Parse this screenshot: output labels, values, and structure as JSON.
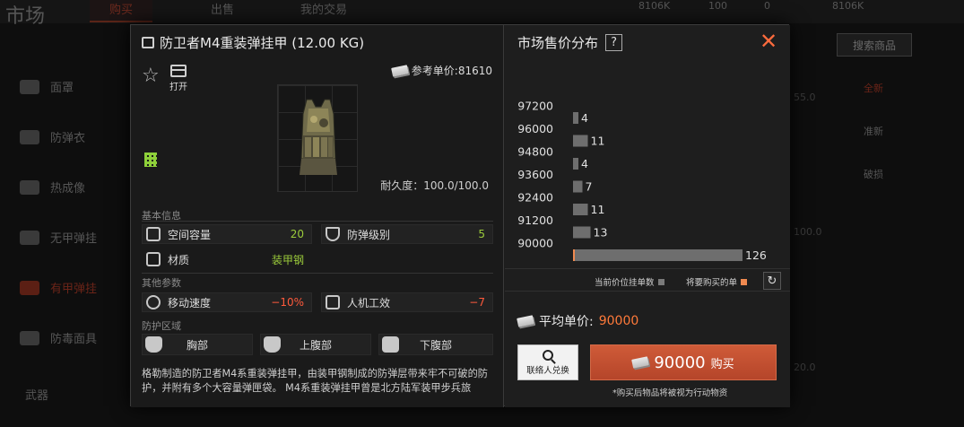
{
  "background": {
    "title": "市场",
    "tabs": [
      "购买",
      "出售",
      "我的交易"
    ],
    "currency": [
      "8106K",
      "100",
      "0",
      "8106K"
    ],
    "sidebar": [
      "面罩",
      "防弹衣",
      "热成像",
      "无甲弹挂",
      "有甲弹挂",
      "防毒面具",
      "武器"
    ],
    "search_btn": "搜索商品",
    "right_items": [
      "全新",
      "准新",
      "破损"
    ],
    "ghost": [
      "55.0",
      "100.0",
      "20.0"
    ]
  },
  "item": {
    "name": "防卫者M4重装弹挂甲 (12.00 KG)",
    "open_label": "打开",
    "ref_price": "参考单价:81610",
    "durability": "耐久度：100.0/100.0",
    "basic_label": "基本信息",
    "stats_basic": [
      {
        "name": "空间容量",
        "value": "20"
      },
      {
        "name": "防弹级别",
        "value": "5"
      },
      {
        "name": "材质",
        "value": "装甲钢"
      }
    ],
    "other_label": "其他参数",
    "stats_other": [
      {
        "name": "移动速度",
        "value": "−10%"
      },
      {
        "name": "人机工效",
        "value": "−7"
      }
    ],
    "zones_label": "防护区域",
    "zones": [
      "胸部",
      "上腹部",
      "下腹部"
    ],
    "description": "格勒制造的防卫者M4系重装弹挂甲，由装甲钢制成的防弹层带来牢不可破的防护，并附有多个大容量弹匣袋。 M4系重装弹挂甲曾是北方陆军装甲步兵旅"
  },
  "market": {
    "title": "市场售价分布",
    "help": "?",
    "legend_current": "当前价位挂单数",
    "legend_buy": "将要购买的单",
    "avg_label": "平均单价:",
    "avg_value": "90000",
    "contact_label": "联络人兑换",
    "buy_price": "90000",
    "buy_label": "购买",
    "note": "*购买后物品将被视为行动物资",
    "colors": {
      "bar": "#6e6e6e",
      "selected": "#f08a50",
      "accent": "#c9532f"
    }
  },
  "chart_data": {
    "type": "bar",
    "orientation": "horizontal",
    "y_ticks": [
      "97200",
      "96000",
      "94800",
      "93600",
      "92400",
      "91200",
      "90000"
    ],
    "series": [
      {
        "values": [
          4,
          11,
          4,
          7,
          11,
          13,
          126
        ]
      }
    ],
    "xlim": [
      0,
      130
    ]
  }
}
